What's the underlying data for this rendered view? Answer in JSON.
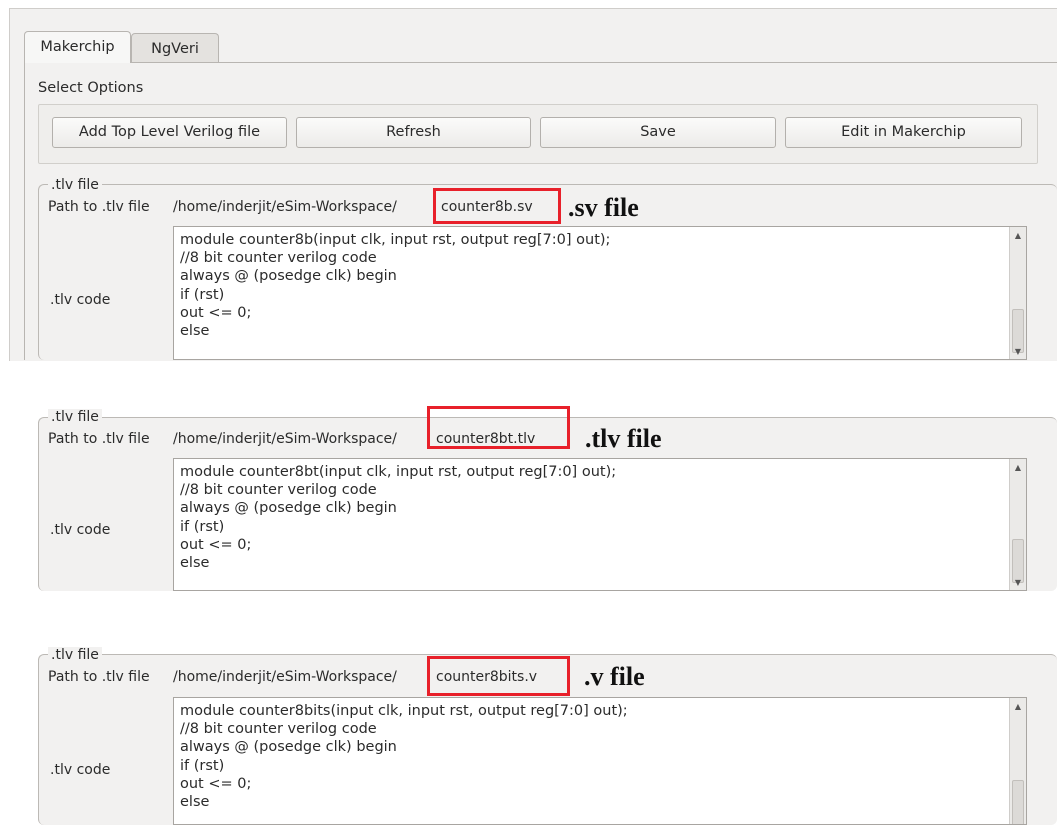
{
  "tabs": [
    {
      "label": "Makerchip"
    },
    {
      "label": "NgVeri"
    }
  ],
  "options": {
    "title": "Select Options",
    "buttons": [
      {
        "label": "Add Top Level Verilog file"
      },
      {
        "label": "Refresh"
      },
      {
        "label": "Save"
      },
      {
        "label": "Edit in Makerchip"
      }
    ]
  },
  "panels": [
    {
      "legend": ".tlv file",
      "path_label": "Path to .tlv file",
      "path_dir": "/home/inderjit/eSim-Workspace/",
      "path_file": "counter8b.sv",
      "annotation": ".sv file",
      "code_label": ".tlv code",
      "code": [
        "module counter8b(input clk, input rst, output reg[7:0] out);",
        "//8 bit counter verilog code",
        "always @ (posedge clk) begin",
        "if (rst)",
        "out <= 0;",
        "else"
      ]
    },
    {
      "legend": ".tlv file",
      "path_label": "Path to .tlv file",
      "path_dir": "/home/inderjit/eSim-Workspace/",
      "path_file": "counter8bt.tlv",
      "annotation": ".tlv file",
      "code_label": ".tlv code",
      "code": [
        "module counter8bt(input clk, input rst, output reg[7:0] out);",
        "//8 bit counter verilog code",
        "always @ (posedge clk) begin",
        "if (rst)",
        "out <= 0;",
        "else"
      ]
    },
    {
      "legend": ".tlv file",
      "path_label": "Path to .tlv file",
      "path_dir": "/home/inderjit/eSim-Workspace/",
      "path_file": "counter8bits.v",
      "annotation": ".v file",
      "code_label": ".tlv code",
      "code": [
        "module counter8bits(input clk, input rst, output reg[7:0] out);",
        "//8 bit counter verilog code",
        "always @ (posedge clk) begin",
        "if (rst)",
        "out <= 0;",
        "else"
      ]
    }
  ],
  "colors": {
    "highlight": "#e8202a",
    "panel_bg": "#f2f1f0"
  },
  "icons": {
    "scroll_up": "triangle-up-icon",
    "scroll_down": "triangle-down-icon"
  }
}
